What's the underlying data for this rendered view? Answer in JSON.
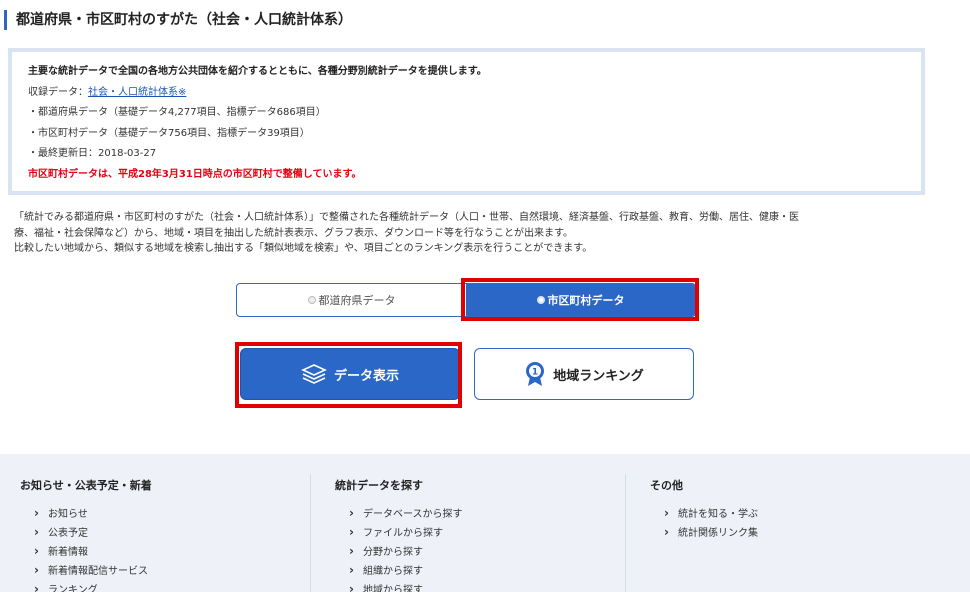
{
  "page_title": "都道府県・市区町村のすがた（社会・人口統計体系）",
  "info": {
    "heading": "主要な統計データで全国の各地方公共団体を紹介するとともに、各種分野別統計データを提供します。",
    "collection_prefix": "収録データ：",
    "collection_link": "社会・人口統計体系※",
    "prefecture_data": "・都道府県データ（基礎データ4,277項目、指標データ686項目）",
    "municipal_data": "・市区町村データ（基礎データ756項目、指標データ39項目）",
    "last_updated": "・最終更新日：2018-03-27",
    "notice": "市区町村データは、平成28年3月31日時点の市区町村で整備しています。"
  },
  "description": {
    "line1": "「統計でみる都道府県・市区町村のすがた（社会・人口統計体系）」で整備された各種統計データ（人口・世帯、自然環境、経済基盤、行政基盤、教育、労働、居住、健康・医",
    "line2": "療、福祉・社会保障など）から、地域・項目を抽出した統計表表示、グラフ表示、ダウンロード等を行なうことが出来ます。",
    "line3": "比較したい地域から、類似する地域を検索し抽出する「類似地域を検索」や、項目ごとのランキング表示を行うことができます。"
  },
  "toggle": {
    "prefecture": "都道府県データ",
    "municipal": "市区町村データ",
    "selected": "市区町村データ"
  },
  "actions": {
    "data_display": "データ表示",
    "ranking": "地域ランキング"
  },
  "footer": {
    "col1": {
      "title": "お知らせ・公表予定・新着",
      "items": [
        "お知らせ",
        "公表予定",
        "新着情報",
        "新着情報配信サービス",
        "ランキング"
      ]
    },
    "col2": {
      "title": "統計データを探す",
      "items": [
        "データベースから探す",
        "ファイルから探す",
        "分野から探す",
        "組織から探す",
        "地域から探す"
      ]
    },
    "col3": {
      "title": "その他",
      "items": [
        "統計を知る・学ぶ",
        "統計関係リンク集"
      ]
    }
  },
  "colors": {
    "accent": "#2b67c6",
    "highlight": "#e00000",
    "notice": "#e60012",
    "footer_bg": "#eef2f8"
  }
}
